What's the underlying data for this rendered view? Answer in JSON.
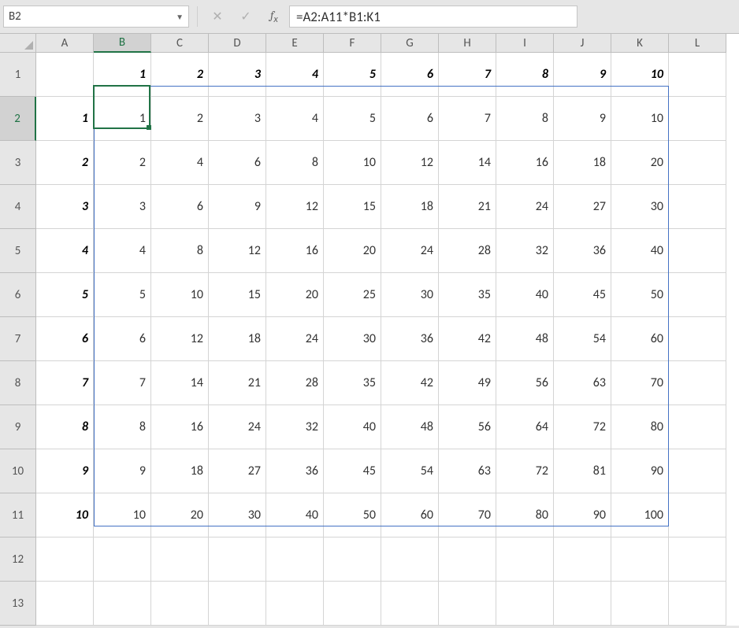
{
  "namebox": {
    "value": "B2"
  },
  "formula": {
    "value": "=A2:A11*B1:K1"
  },
  "columns": [
    "A",
    "B",
    "C",
    "D",
    "E",
    "F",
    "G",
    "H",
    "I",
    "J",
    "K",
    "L"
  ],
  "active": {
    "col": "B",
    "row": 2
  },
  "spill_range": "B2:K11",
  "row1": {
    "headers": [
      "",
      "1",
      "2",
      "3",
      "4",
      "5",
      "6",
      "7",
      "8",
      "9",
      "10",
      ""
    ]
  },
  "chart_data": {
    "type": "table",
    "row_labels": [
      1,
      2,
      3,
      4,
      5,
      6,
      7,
      8,
      9,
      10
    ],
    "col_labels": [
      1,
      2,
      3,
      4,
      5,
      6,
      7,
      8,
      9,
      10
    ],
    "values": [
      [
        1,
        2,
        3,
        4,
        5,
        6,
        7,
        8,
        9,
        10
      ],
      [
        2,
        4,
        6,
        8,
        10,
        12,
        14,
        16,
        18,
        20
      ],
      [
        3,
        6,
        9,
        12,
        15,
        18,
        21,
        24,
        27,
        30
      ],
      [
        4,
        8,
        12,
        16,
        20,
        24,
        28,
        32,
        36,
        40
      ],
      [
        5,
        10,
        15,
        20,
        25,
        30,
        35,
        40,
        45,
        50
      ],
      [
        6,
        12,
        18,
        24,
        30,
        36,
        42,
        48,
        54,
        60
      ],
      [
        7,
        14,
        21,
        28,
        35,
        42,
        49,
        56,
        63,
        70
      ],
      [
        8,
        16,
        24,
        32,
        40,
        48,
        56,
        64,
        72,
        80
      ],
      [
        9,
        18,
        27,
        36,
        45,
        54,
        63,
        72,
        81,
        90
      ],
      [
        10,
        20,
        30,
        40,
        50,
        60,
        70,
        80,
        90,
        100
      ]
    ]
  },
  "extra_rows": [
    12,
    13
  ]
}
